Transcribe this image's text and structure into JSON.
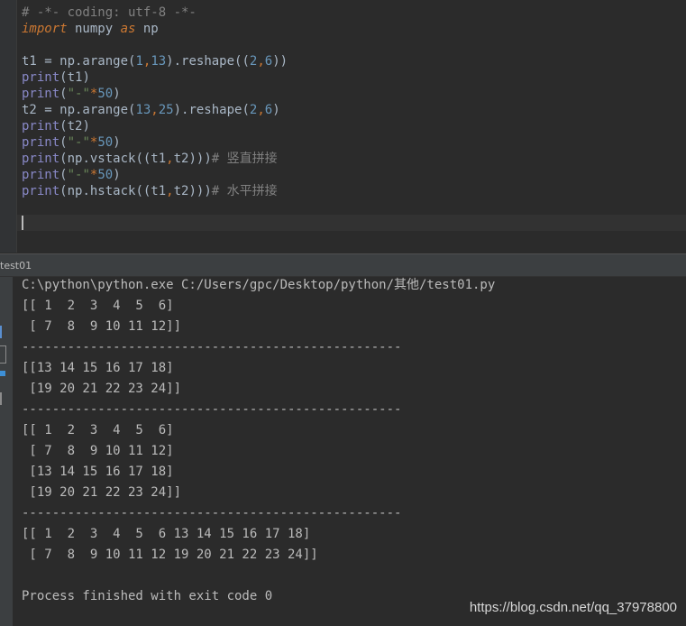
{
  "editor": {
    "lines": [
      [
        {
          "t": "# -*- coding: utf-8 -*-",
          "c": "comment"
        }
      ],
      [
        {
          "t": "import",
          "c": "kw"
        },
        {
          "t": " numpy ",
          "c": "plain"
        },
        {
          "t": "as",
          "c": "kw"
        },
        {
          "t": " np",
          "c": "plain"
        }
      ],
      [],
      [
        {
          "t": "t1 = np.arange(",
          "c": "plain"
        },
        {
          "t": "1",
          "c": "num"
        },
        {
          "t": ",",
          "c": "op"
        },
        {
          "t": "13",
          "c": "num"
        },
        {
          "t": ").reshape((",
          "c": "plain"
        },
        {
          "t": "2",
          "c": "num"
        },
        {
          "t": ",",
          "c": "op"
        },
        {
          "t": "6",
          "c": "num"
        },
        {
          "t": "))",
          "c": "plain"
        }
      ],
      [
        {
          "t": "print",
          "c": "builtin"
        },
        {
          "t": "(t1)",
          "c": "plain"
        }
      ],
      [
        {
          "t": "print",
          "c": "builtin"
        },
        {
          "t": "(",
          "c": "plain"
        },
        {
          "t": "\"-\"",
          "c": "str"
        },
        {
          "t": "*",
          "c": "op"
        },
        {
          "t": "50",
          "c": "num"
        },
        {
          "t": ")",
          "c": "plain"
        }
      ],
      [
        {
          "t": "t2 = np.arange(",
          "c": "plain"
        },
        {
          "t": "13",
          "c": "num"
        },
        {
          "t": ",",
          "c": "op"
        },
        {
          "t": "25",
          "c": "num"
        },
        {
          "t": ").reshape(",
          "c": "plain"
        },
        {
          "t": "2",
          "c": "num"
        },
        {
          "t": ",",
          "c": "op"
        },
        {
          "t": "6",
          "c": "num"
        },
        {
          "t": ")",
          "c": "plain"
        }
      ],
      [
        {
          "t": "print",
          "c": "builtin"
        },
        {
          "t": "(t2)",
          "c": "plain"
        }
      ],
      [
        {
          "t": "print",
          "c": "builtin"
        },
        {
          "t": "(",
          "c": "plain"
        },
        {
          "t": "\"-\"",
          "c": "str"
        },
        {
          "t": "*",
          "c": "op"
        },
        {
          "t": "50",
          "c": "num"
        },
        {
          "t": ")",
          "c": "plain"
        }
      ],
      [
        {
          "t": "print",
          "c": "builtin"
        },
        {
          "t": "(np.vstack((t1",
          "c": "plain"
        },
        {
          "t": ",",
          "c": "op"
        },
        {
          "t": "t2)))",
          "c": "plain"
        },
        {
          "t": "# ",
          "c": "comment"
        },
        {
          "t": "竖直拼接",
          "c": "comment-cjk"
        }
      ],
      [
        {
          "t": "print",
          "c": "builtin"
        },
        {
          "t": "(",
          "c": "plain"
        },
        {
          "t": "\"-\"",
          "c": "str"
        },
        {
          "t": "*",
          "c": "op"
        },
        {
          "t": "50",
          "c": "num"
        },
        {
          "t": ")",
          "c": "plain"
        }
      ],
      [
        {
          "t": "print",
          "c": "builtin"
        },
        {
          "t": "(np.hstack((t1",
          "c": "plain"
        },
        {
          "t": ",",
          "c": "op"
        },
        {
          "t": "t2)))",
          "c": "plain"
        },
        {
          "t": "# ",
          "c": "comment"
        },
        {
          "t": "水平拼接",
          "c": "comment-cjk"
        }
      ]
    ]
  },
  "run_panel": {
    "tab_label": "test01"
  },
  "console": {
    "lines": [
      "C:\\python\\python.exe C:/Users/gpc/Desktop/python/其他/test01.py",
      "[[ 1  2  3  4  5  6]",
      " [ 7  8  9 10 11 12]]",
      "--------------------------------------------------",
      "[[13 14 15 16 17 18]",
      " [19 20 21 22 23 24]]",
      "--------------------------------------------------",
      "[[ 1  2  3  4  5  6]",
      " [ 7  8  9 10 11 12]",
      " [13 14 15 16 17 18]",
      " [19 20 21 22 23 24]]",
      "--------------------------------------------------",
      "[[ 1  2  3  4  5  6 13 14 15 16 17 18]",
      " [ 7  8  9 10 11 12 19 20 21 22 23 24]]",
      "",
      "Process finished with exit code 0"
    ]
  },
  "watermark": "https://blog.csdn.net/qq_37978800",
  "colors": {
    "background": "#2b2b2b",
    "keyword": "#cc7832",
    "number": "#6897bb",
    "string": "#6a8759",
    "builtin": "#8888c6",
    "comment": "#808080",
    "console_text": "#bbbbbb"
  }
}
